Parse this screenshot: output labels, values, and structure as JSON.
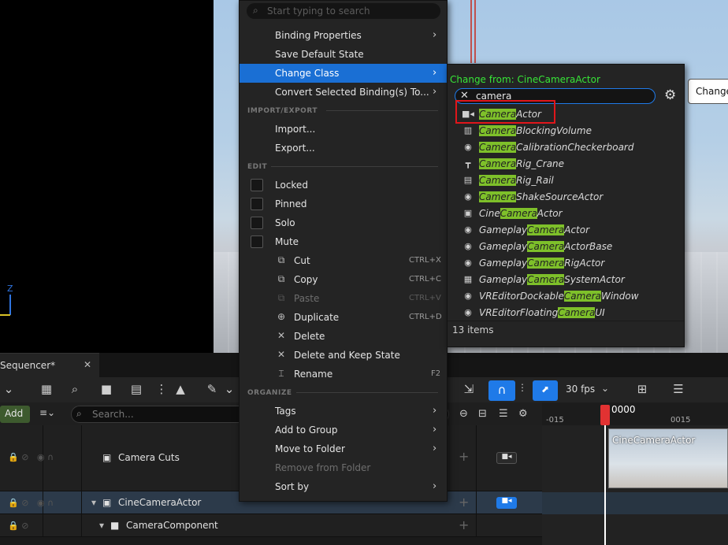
{
  "viewport": {
    "axis_label": "Z",
    "change_button_label": "Change"
  },
  "context_menu": {
    "search_placeholder": "Start typing to search",
    "items_top": [
      {
        "label": "Binding Properties",
        "submenu": true
      },
      {
        "label": "Save Default State",
        "submenu": false
      },
      {
        "label": "Change Class",
        "submenu": true,
        "active": true
      },
      {
        "label": "Convert Selected Binding(s) To...",
        "submenu": true
      }
    ],
    "sections": {
      "import_export": "IMPORT/EXPORT",
      "edit": "EDIT",
      "organize": "ORGANIZE"
    },
    "import_export_items": [
      {
        "label": "Import..."
      },
      {
        "label": "Export..."
      }
    ],
    "edit_checks": [
      {
        "label": "Locked",
        "checked": false
      },
      {
        "label": "Pinned",
        "checked": false
      },
      {
        "label": "Solo",
        "checked": false
      },
      {
        "label": "Mute",
        "checked": false
      }
    ],
    "edit_actions": [
      {
        "label": "Cut",
        "shortcut": "CTRL+X",
        "icon": "cut-icon",
        "enabled": true
      },
      {
        "label": "Copy",
        "shortcut": "CTRL+C",
        "icon": "copy-icon",
        "enabled": true
      },
      {
        "label": "Paste",
        "shortcut": "CTRL+V",
        "icon": "paste-icon",
        "enabled": false
      },
      {
        "label": "Duplicate",
        "shortcut": "CTRL+D",
        "icon": "duplicate-icon",
        "enabled": true
      },
      {
        "label": "Delete",
        "shortcut": "",
        "icon": "delete-icon",
        "enabled": true
      },
      {
        "label": "Delete and Keep State",
        "shortcut": "",
        "icon": "delete-keep-icon",
        "enabled": true
      },
      {
        "label": "Rename",
        "shortcut": "F2",
        "icon": "rename-icon",
        "enabled": true
      }
    ],
    "organize_items": [
      {
        "label": "Tags",
        "submenu": true,
        "enabled": true
      },
      {
        "label": "Add to Group",
        "submenu": true,
        "enabled": true
      },
      {
        "label": "Move to Folder",
        "submenu": true,
        "enabled": true
      },
      {
        "label": "Remove from Folder",
        "submenu": false,
        "enabled": false
      },
      {
        "label": "Sort by",
        "submenu": true,
        "enabled": true
      }
    ]
  },
  "class_menu": {
    "change_from": "Change from: CineCameraActor",
    "search_value": "camera",
    "match": "Camera",
    "items": [
      {
        "pre": "",
        "hl": "Camera",
        "post": "Actor",
        "icon": "camera-icon",
        "boxed": true
      },
      {
        "pre": "",
        "hl": "Camera",
        "post": "BlockingVolume",
        "icon": "volume-icon"
      },
      {
        "pre": "",
        "hl": "Camera",
        "post": "CalibrationCheckerboard",
        "icon": "actor-icon"
      },
      {
        "pre": "",
        "hl": "Camera",
        "post": "Rig_Crane",
        "icon": "crane-icon"
      },
      {
        "pre": "",
        "hl": "Camera",
        "post": "Rig_Rail",
        "icon": "rail-icon"
      },
      {
        "pre": "",
        "hl": "Camera",
        "post": "ShakeSourceActor",
        "icon": "actor-icon"
      },
      {
        "pre": "Cine",
        "hl": "Camera",
        "post": "Actor",
        "icon": "cine-camera-icon"
      },
      {
        "pre": "Gameplay",
        "hl": "Camera",
        "post": "Actor",
        "icon": "actor-icon"
      },
      {
        "pre": "Gameplay",
        "hl": "Camera",
        "post": "ActorBase",
        "icon": "actor-icon"
      },
      {
        "pre": "Gameplay",
        "hl": "Camera",
        "post": "RigActor",
        "icon": "actor-icon"
      },
      {
        "pre": "Gameplay",
        "hl": "Camera",
        "post": "SystemActor",
        "icon": "system-icon"
      },
      {
        "pre": "VREditorDockable",
        "hl": "Camera",
        "post": "Window",
        "icon": "actor-icon"
      },
      {
        "pre": "VREditorFloating",
        "hl": "Camera",
        "post": "UI",
        "icon": "actor-icon"
      }
    ],
    "count_label": "13 items"
  },
  "sequencer": {
    "tab_label": "Sequencer*",
    "add_label": "Add",
    "search_placeholder": "Search...",
    "fps_label": "30 fps",
    "ruler": {
      "neg": "-015",
      "current": "0000",
      "pos": "0015"
    },
    "tracks": [
      {
        "label": "Camera Cuts",
        "icon": "camera-cuts-icon"
      },
      {
        "label": "CineCameraActor",
        "icon": "cine-camera-icon",
        "selected": true
      },
      {
        "label": "CameraComponent",
        "icon": "camera-icon"
      }
    ],
    "clip_label": "CineCameraActor"
  },
  "colors": {
    "accent": "#1a6fd4",
    "match_highlight": "#7ec02a",
    "change_from_text": "#37e637",
    "callout_box": "#e0161b"
  }
}
